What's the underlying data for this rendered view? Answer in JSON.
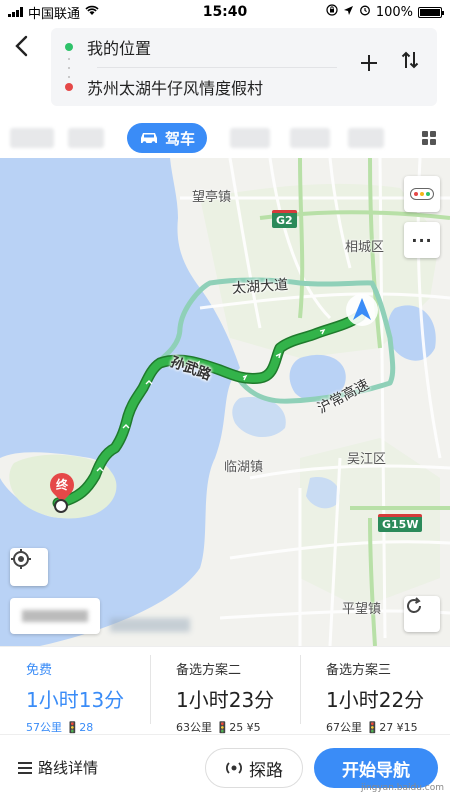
{
  "status_bar": {
    "carrier": "中国联通",
    "time": "15:40",
    "battery": "100%"
  },
  "route": {
    "origin": "我的位置",
    "destination": "苏州太湖牛仔风情度假村",
    "origin_color": "#2ec26a",
    "destination_color": "#e54848"
  },
  "modes": {
    "active_label": "驾车"
  },
  "map": {
    "labels": {
      "wangting": "望亭镇",
      "xiangcheng": "相城区",
      "linhu": "临湖镇",
      "wujiang": "吴江区",
      "pingwang": "平望镇"
    },
    "roads": {
      "taihu_avenue": "太湖大道",
      "huwu_road": "孙武路",
      "huchang_highway": "沪常高速"
    },
    "shields": {
      "g2": "G2",
      "g15w": "G15W"
    },
    "end_marker": "终",
    "route_color": "#33b34a",
    "alt_route_color": "#8fd0b8",
    "water_color": "#b9d2f5",
    "land_color": "#f2f2ee"
  },
  "plans": [
    {
      "label": "免费",
      "time": "1小时13分",
      "meta": "57公里 🚦28",
      "selected": true
    },
    {
      "label": "备选方案二",
      "time": "1小时23分",
      "meta": "63公里 🚦25 ¥5",
      "selected": false
    },
    {
      "label": "备选方案三",
      "time": "1小时22分",
      "meta": "67公里 🚦27 ¥15",
      "selected": false
    }
  ],
  "bottom": {
    "details_label": "路线详情",
    "explore_label": "探路",
    "go_label": "开始导航",
    "watermark": "jingyan.baidu.com"
  },
  "colors": {
    "accent": "#3a8cf7"
  }
}
